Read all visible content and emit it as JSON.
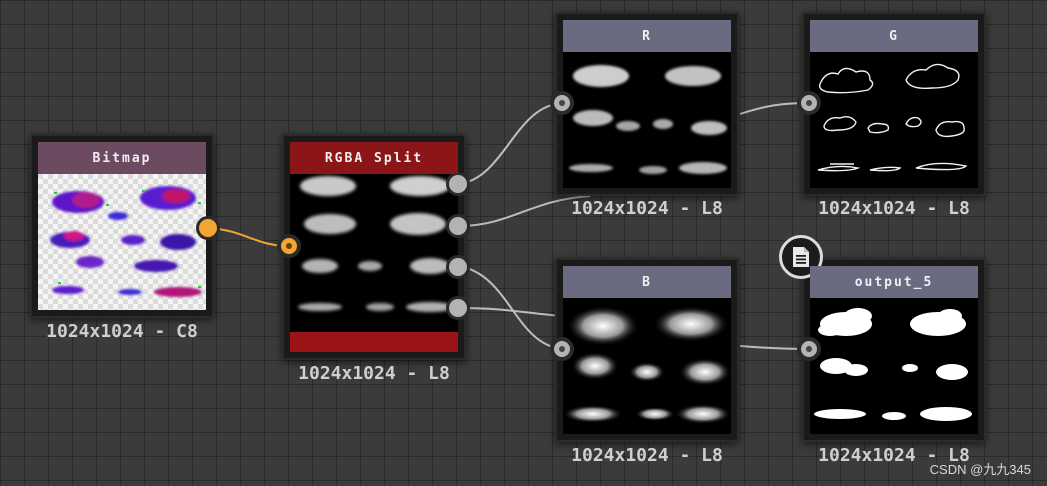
{
  "nodes": {
    "bitmap": {
      "title": "Bitmap",
      "caption": "1024x1024 - C8",
      "header_color": "#6b4a62"
    },
    "rgba_split": {
      "title": "RGBA Split",
      "caption": "1024x1024 - L8",
      "header_color": "#8c1518"
    },
    "r": {
      "title": "R",
      "caption": "1024x1024 - L8",
      "header_color": "#6a6a80"
    },
    "g": {
      "title": "G",
      "caption": "1024x1024 - L8",
      "header_color": "#6a6a80"
    },
    "b": {
      "title": "B",
      "caption": "1024x1024 - L8",
      "header_color": "#6a6a80"
    },
    "output_5": {
      "title": "output_5",
      "caption": "1024x1024 - L8",
      "header_color": "#6a6a80",
      "badge_icon": "document-icon"
    }
  },
  "watermark": "CSDN @九九345",
  "colors": {
    "wire": "#bdbdbd",
    "orange_wire": "#f3a534",
    "canvas_bg": "#3b3b3b"
  }
}
